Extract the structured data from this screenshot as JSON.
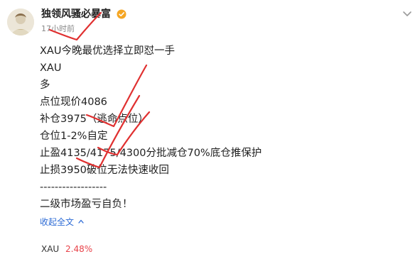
{
  "post": {
    "author": "独领风骚必暴富",
    "timestamp": "17小时前",
    "lines": [
      "XAU今晚最优选择立即怼一手",
      "XAU",
      "多",
      "点位现价4086",
      "补仓3975（逃命点位）",
      "仓位1-2%自定",
      "止盈4135/4175/4300分批减仓70%底仓推保护",
      "止损3950破位无法快速收回",
      "------------------",
      "二级市场盈亏自负！"
    ],
    "collapse_label": "收起全文"
  },
  "ticker": {
    "symbol": "XAU",
    "change": "2.48%"
  },
  "colors": {
    "link": "#2d6bd5",
    "gain": "#e8434a",
    "verified": "#f5a623",
    "annotation": "#e03030"
  },
  "icons": {
    "verified": "verified-badge-icon",
    "more": "more-options-icon",
    "chevron": "chevron-up-icon"
  }
}
